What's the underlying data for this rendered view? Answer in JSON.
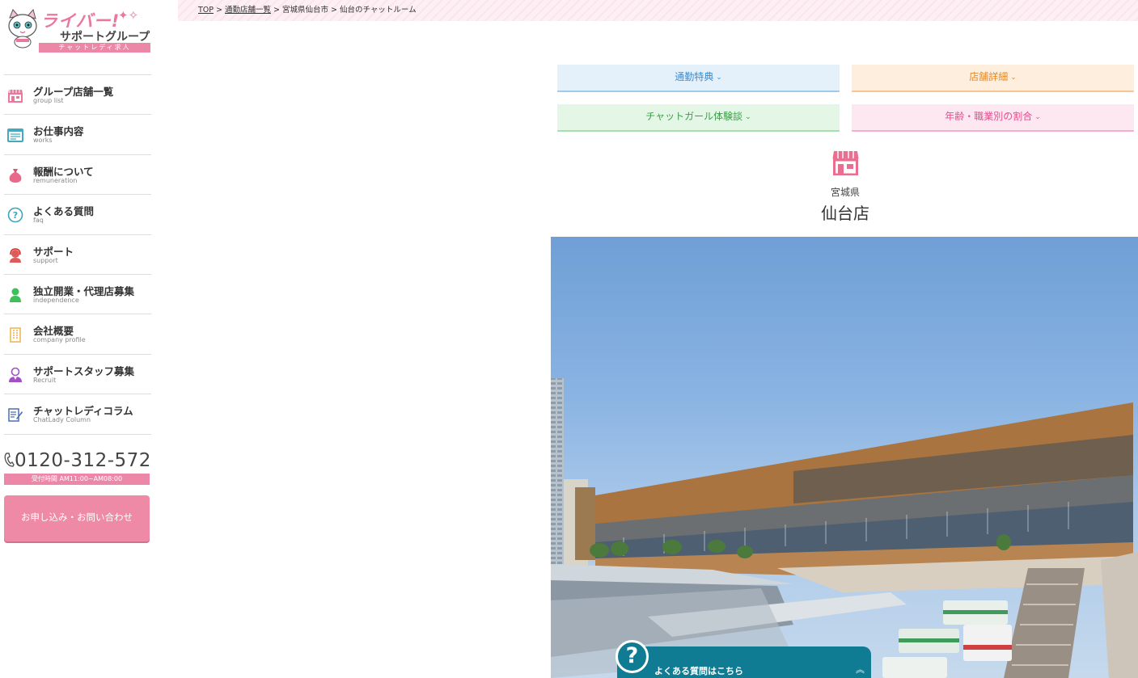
{
  "logo": {
    "line1": "ライバー!",
    "line2": "サポートグループ",
    "band": "チャットレディ求人"
  },
  "sidebar": {
    "items": [
      {
        "label": "グループ店舗一覧",
        "sub": "group list",
        "icon": "shop-icon"
      },
      {
        "label": "お仕事内容",
        "sub": "works",
        "icon": "document-icon"
      },
      {
        "label": "報酬について",
        "sub": "remuneration",
        "icon": "money-bag-icon"
      },
      {
        "label": "よくある質問",
        "sub": "faq",
        "icon": "question-icon"
      },
      {
        "label": "サポート",
        "sub": "support",
        "icon": "headset-icon"
      },
      {
        "label": "独立開業・代理店募集",
        "sub": "independence",
        "icon": "person-icon"
      },
      {
        "label": "会社概要",
        "sub": "company profile",
        "icon": "building-icon"
      },
      {
        "label": "サポートスタッフ募集",
        "sub": "Recruit",
        "icon": "staff-icon"
      },
      {
        "label": "チャットレディコラム",
        "sub": "ChatLady Column",
        "icon": "pencil-note-icon"
      }
    ],
    "phone": "0120-312-572",
    "hours": "受付時間 AM11:00~AM08:00",
    "apply_label": "お申し込み・お問い合わせ"
  },
  "breadcrumb": {
    "items": [
      "TOP",
      "通勤店舗一覧",
      "宮城県仙台市",
      "仙台のチャットルーム"
    ],
    "separator": ">"
  },
  "tabs": [
    {
      "label": "通勤特典",
      "color": "#3b8bd0"
    },
    {
      "label": "店舗詳細",
      "color": "#e28a2c"
    },
    {
      "label": "チャットガール体験談",
      "color": "#3aa046"
    },
    {
      "label": "年齢・職業別の割合",
      "color": "#e0508f"
    }
  ],
  "tab_chevron": "⌄",
  "store": {
    "prefecture": "宮城県",
    "name": "仙台店",
    "icon": "shop-icon"
  },
  "faq": {
    "badge": "?",
    "label": "よくある質問はこちら",
    "caret": "︽"
  },
  "colors": {
    "brand_pink": "#ec87a8",
    "faq_teal": "#0f7c93"
  }
}
